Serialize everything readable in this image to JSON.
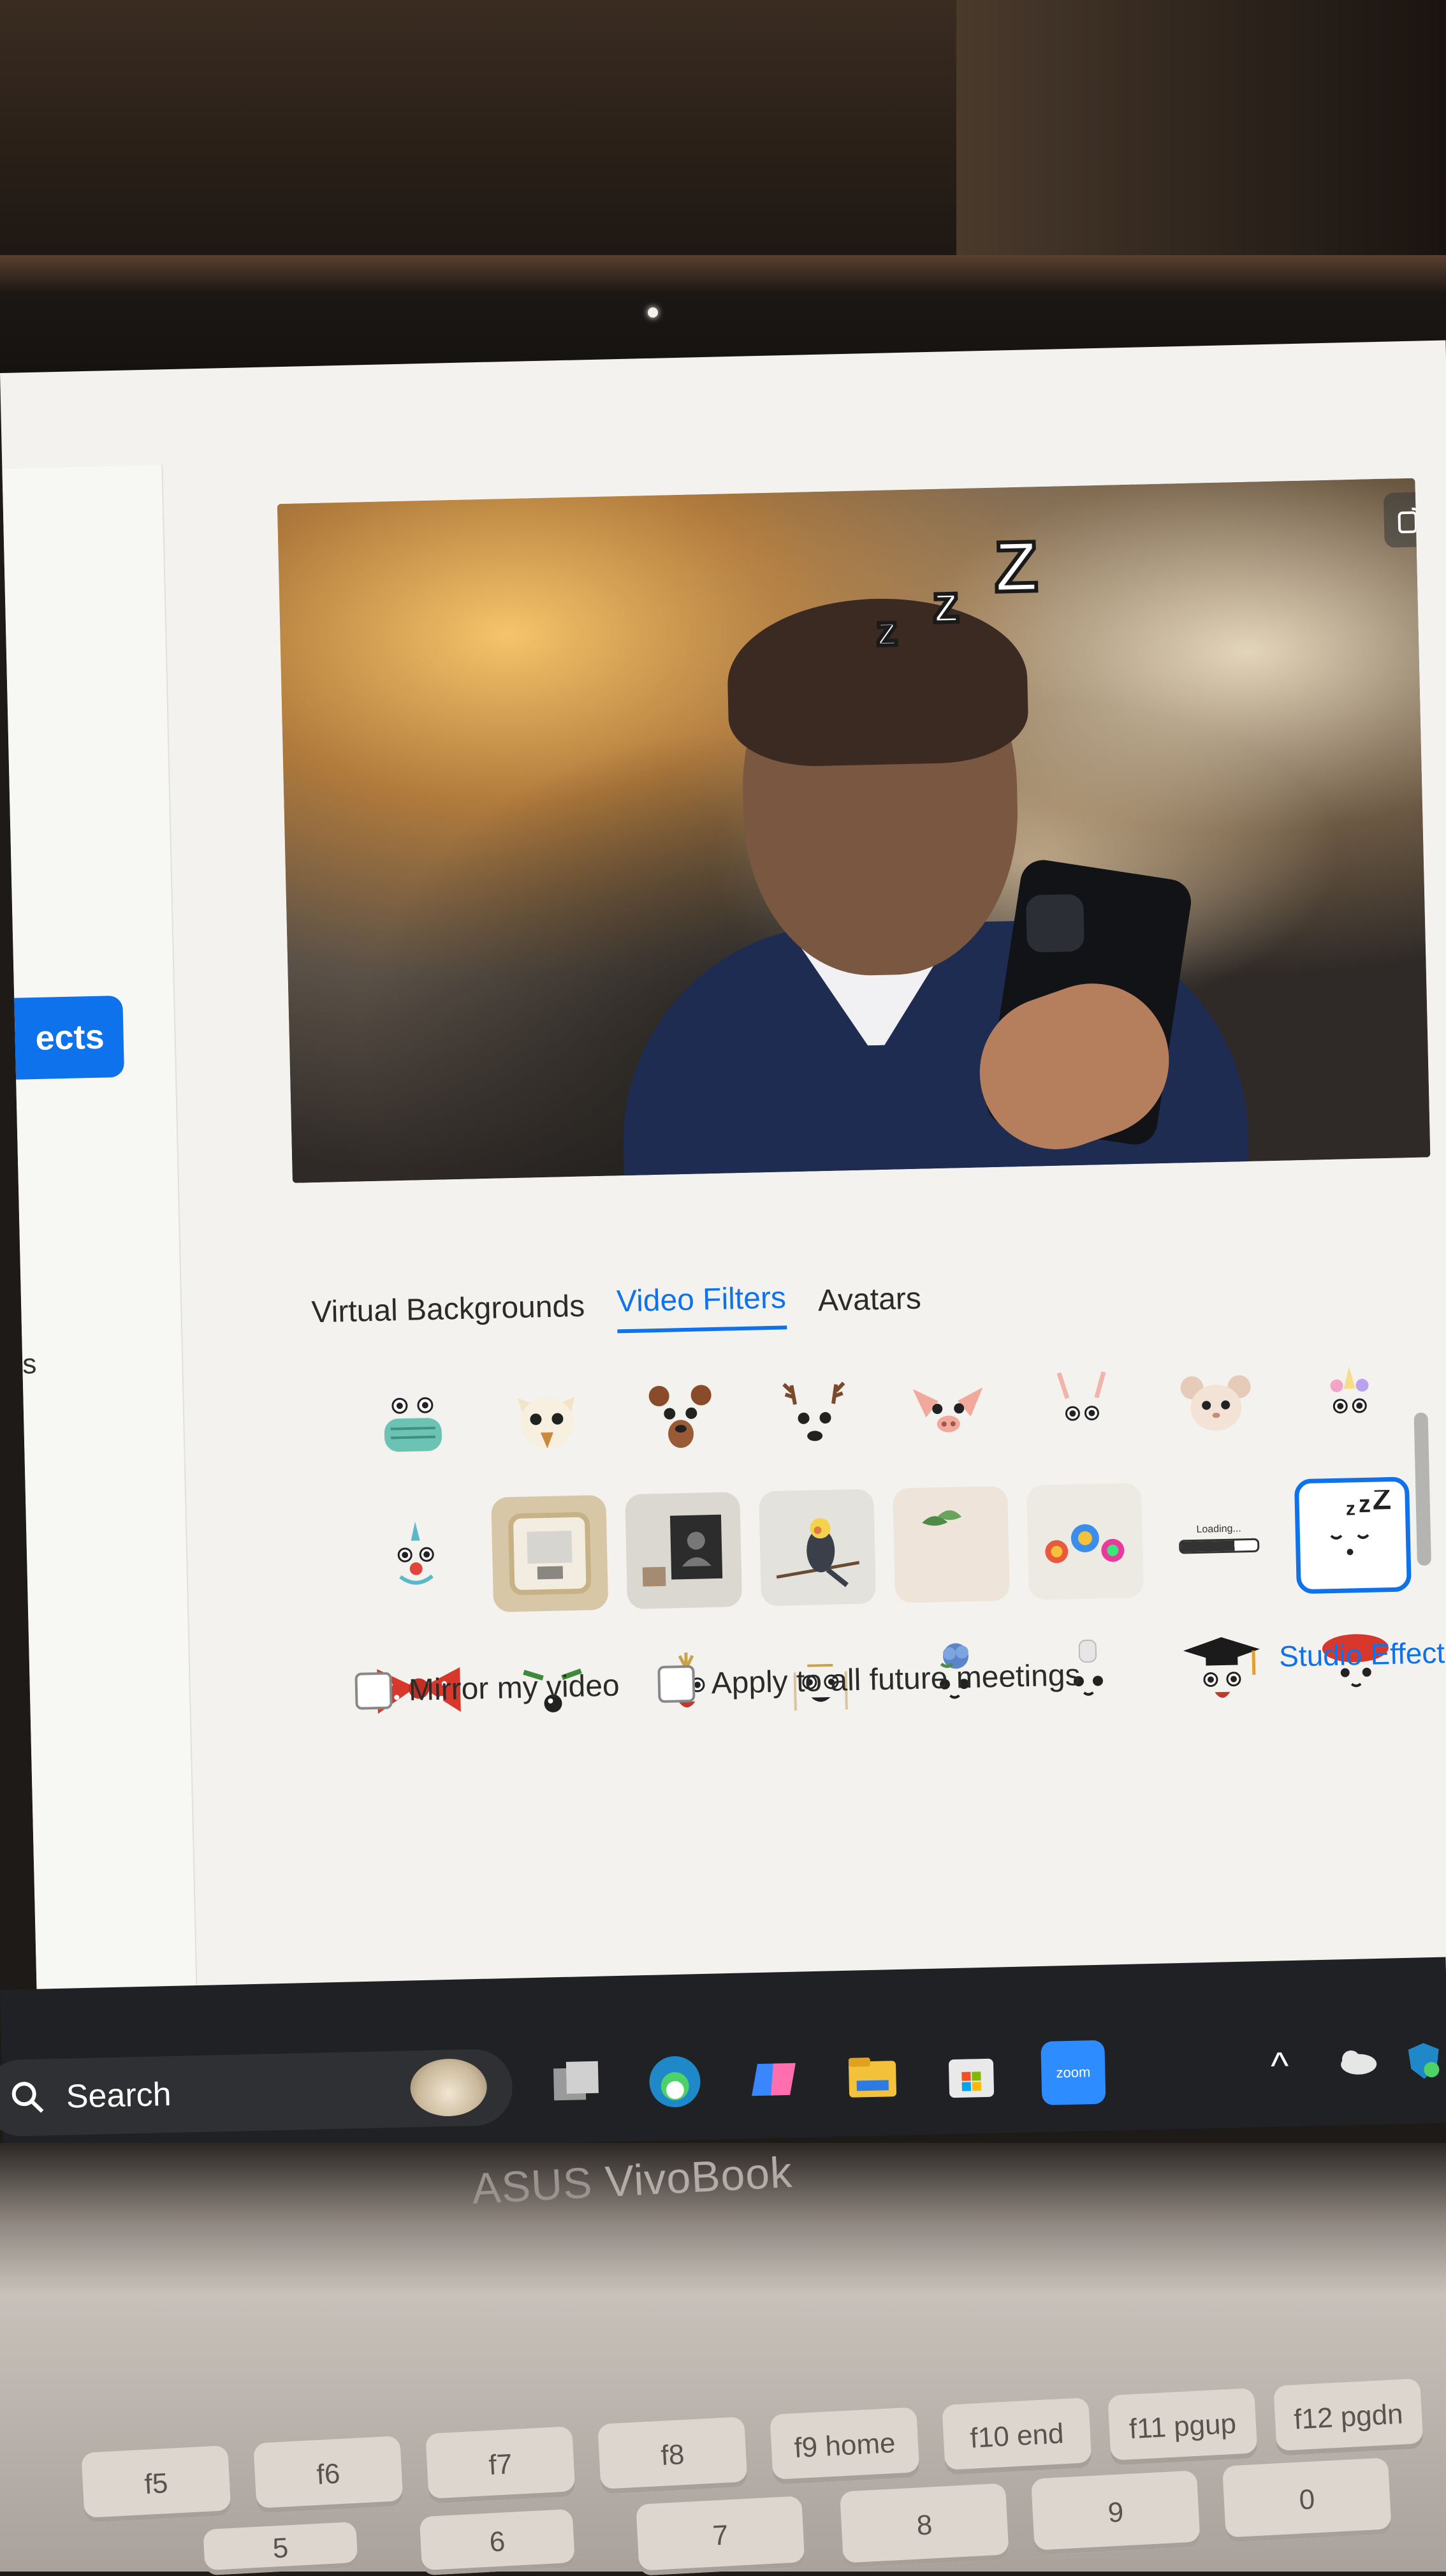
{
  "sidebar": {
    "active_item_label": "ects",
    "fragment_label": "s"
  },
  "tabs": [
    {
      "label": "Virtual Backgrounds",
      "active": false
    },
    {
      "label": "Video Filters",
      "active": true
    },
    {
      "label": "Avatars",
      "active": false
    }
  ],
  "preview": {
    "overlay_text": [
      "z",
      "z",
      "Z"
    ]
  },
  "filters": {
    "rows": [
      [
        "face-mask",
        "fox-ears",
        "bear-ears",
        "reindeer-antlers",
        "pig-ears",
        "bunny-ears",
        "hamster-ears",
        "unicorn-horn"
      ],
      [
        "clown-nose",
        "room-frame",
        "portrait-frame",
        "bird-on-branch",
        "leaf-card",
        "lollipops",
        "loading-bar",
        "sleeping-zzz"
      ],
      [
        "red-bow",
        "green-brows",
        "crown-sprout",
        "face-mask-lines",
        "blue-flower",
        "chef-hat",
        "graduation-cap",
        "red-beret"
      ]
    ],
    "selected": "sleeping-zzz",
    "loading_label": "Loading..."
  },
  "options": {
    "mirror_label": "Mirror my video",
    "apply_all_label": "Apply to all future meetings",
    "studio_effects_label": "Studio Effects"
  },
  "taskbar": {
    "search_label": "Search",
    "zoom_label": "zoom"
  },
  "laptop": {
    "brand_asus": "ASUS",
    "brand_vivobook": "VivoBook"
  },
  "keys": {
    "fn_row": [
      "f5",
      "f6",
      "f7",
      "f8",
      "f9 home",
      "f10 end",
      "f11 pgup",
      "f12 pgdn"
    ],
    "num_row": [
      "%",
      "5",
      "^",
      "6",
      "&",
      "7",
      "*",
      "8",
      "(",
      "9",
      ")",
      "0"
    ]
  },
  "colors": {
    "accent": "#0e72ed",
    "taskbar": "#202124",
    "panel": "#f3f2ee"
  }
}
